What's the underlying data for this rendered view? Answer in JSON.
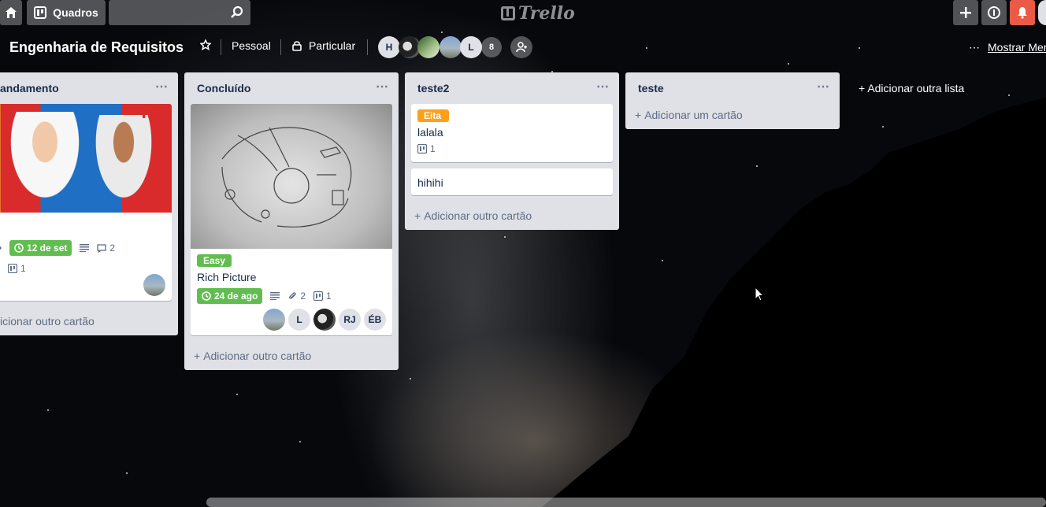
{
  "header": {
    "boards_label": "Quadros",
    "search_placeholder": "",
    "logo_text": "Trello"
  },
  "board": {
    "title": "Engenharia de Requisitos",
    "team": "Pessoal",
    "visibility": "Particular",
    "members": [
      {
        "initials": "H"
      },
      {
        "initials": ""
      },
      {
        "initials": ""
      },
      {
        "initials": ""
      },
      {
        "initials": "L"
      }
    ],
    "member_count": "8",
    "show_menu": "Mostrar Menu",
    "menu_dots": "⋯"
  },
  "lists": [
    {
      "title": "Em andamento",
      "title_visible": "andamento",
      "menu": "⋯",
      "cards": [
        {
          "due": "12 de set",
          "comments": "2",
          "checklist": "1"
        }
      ],
      "add_card": "Adicionar outro cartão",
      "add_card_visible": "icionar outro cartão"
    },
    {
      "title": "Concluído",
      "menu": "⋯",
      "cards": [
        {
          "label": "Easy",
          "label_color": "#61bd4f",
          "title": "Rich Picture",
          "due": "24 de ago",
          "attachments": "2",
          "checklist": "1",
          "members": [
            "",
            "L",
            "",
            "RJ",
            "ÉB"
          ]
        }
      ],
      "add_card": "Adicionar outro cartão"
    },
    {
      "title": "teste2",
      "menu": "⋯",
      "cards": [
        {
          "label": "Eita",
          "label_color": "#ff9f1a",
          "title": "lalala",
          "checklist": "1"
        },
        {
          "title": "hihihi"
        }
      ],
      "add_card": "Adicionar outro cartão"
    },
    {
      "title": "teste",
      "menu": "⋯",
      "cards": [],
      "add_card": "Adicionar um cartão"
    }
  ],
  "add_list": "Adicionar outra lista",
  "colors": {
    "accent_green": "#61bd4f",
    "label_orange": "#ff9f1a",
    "notification_red": "#eb5a46",
    "list_bg": "#dfe1e6"
  }
}
